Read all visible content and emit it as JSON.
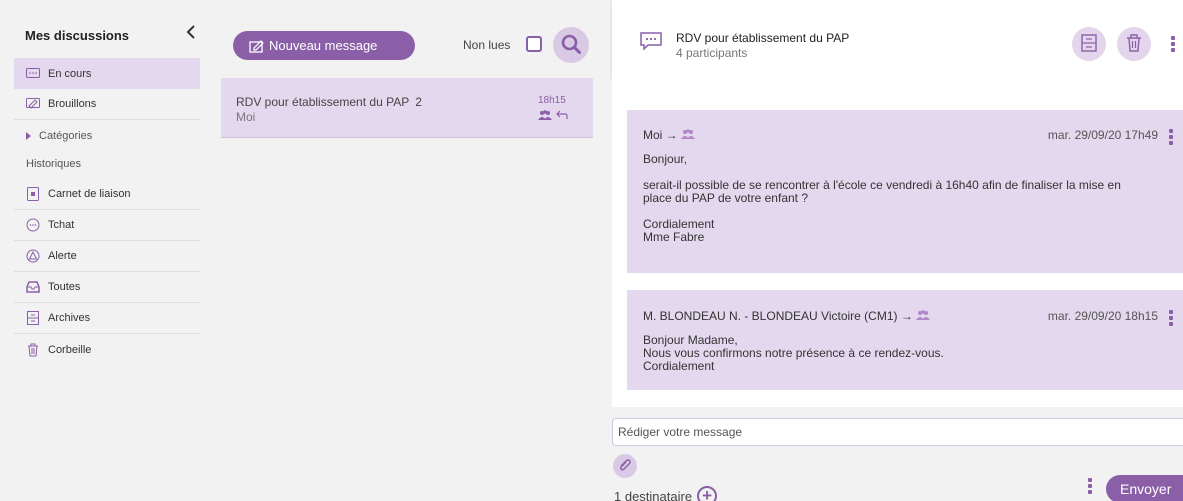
{
  "sidebar": {
    "title": "Mes discussions",
    "collapse_icon": "chevron-left-icon",
    "items": [
      {
        "label": "En cours",
        "icon": "chat-bubble-icon",
        "active": true
      },
      {
        "label": "Brouillons",
        "icon": "draft-icon"
      },
      {
        "label": "Catégories",
        "icon": "caret-right-icon"
      },
      {
        "label": "Historiques"
      },
      {
        "label": "Carnet de liaison",
        "icon": "notebook-icon"
      },
      {
        "label": "Tchat",
        "icon": "chat-icon"
      },
      {
        "label": "Alerte",
        "icon": "alert-icon"
      },
      {
        "label": "Toutes",
        "icon": "inbox-icon"
      },
      {
        "label": "Archives",
        "icon": "archive-icon"
      },
      {
        "label": "Corbeille",
        "icon": "trash-icon"
      }
    ]
  },
  "list": {
    "new_message_label": "Nouveau message",
    "unread_label": "Non lues",
    "conversation": {
      "subject": "RDV pour établissement du PAP",
      "count": "2",
      "from": "Moi",
      "time": "18h15"
    }
  },
  "detail": {
    "title": "RDV pour établissement du PAP",
    "participants": "4 participants",
    "messages": [
      {
        "author": "Moi →",
        "date": "mar. 29/09/20 17h49",
        "body": "Bonjour,\n\nserait-il possible de se rencontrer à l'école ce vendredi à 16h40 afin de finaliser la mise en\nplace du PAP de votre enfant ?\n\nCordialement\nMme Fabre"
      },
      {
        "author": "M. BLONDEAU N. - BLONDEAU Victoire (CM1) →",
        "date": "mar. 29/09/20 18h15",
        "body": "Bonjour Madame,\nNous vous confirmons notre présence à ce rendez-vous.\nCordialement"
      }
    ],
    "compose_placeholder": "Rédiger votre message",
    "recipients": "1 destinataire",
    "send_label": "Envoyer"
  },
  "colors": {
    "accent": "#8b5fa8",
    "accent_light": "#e4d8ee",
    "background": "#f2f2f2"
  }
}
